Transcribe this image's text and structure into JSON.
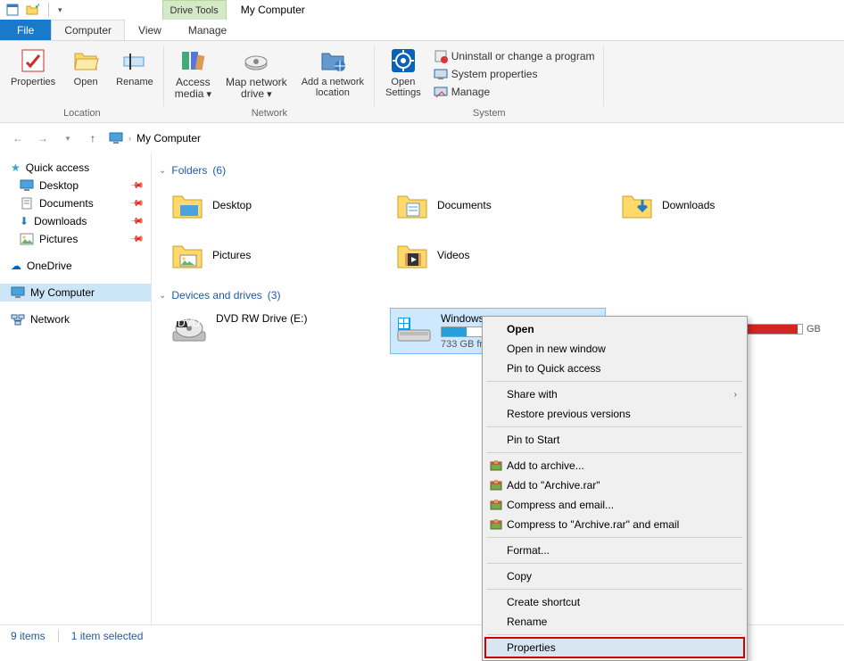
{
  "title": "My Computer",
  "drive_tools_label": "Drive Tools",
  "tabs": {
    "file": "File",
    "computer": "Computer",
    "view": "View",
    "manage": "Manage"
  },
  "ribbon": {
    "location": {
      "label": "Location",
      "properties": "Properties",
      "open": "Open",
      "rename": "Rename"
    },
    "network": {
      "label": "Network",
      "access_media": "Access\nmedia",
      "map_drive": "Map network\ndrive",
      "add_location": "Add a network\nlocation"
    },
    "system": {
      "label": "System",
      "open_settings": "Open\nSettings",
      "uninstall": "Uninstall or change a program",
      "sys_props": "System properties",
      "manage": "Manage"
    }
  },
  "address": "My Computer",
  "sidebar": {
    "quick_access": "Quick access",
    "pinned": [
      {
        "label": "Desktop"
      },
      {
        "label": "Documents"
      },
      {
        "label": "Downloads"
      },
      {
        "label": "Pictures"
      }
    ],
    "onedrive": "OneDrive",
    "my_computer": "My Computer",
    "network": "Network"
  },
  "sections": {
    "folders": {
      "label": "Folders",
      "count": "(6)"
    },
    "devices": {
      "label": "Devices and drives",
      "count": "(3)"
    }
  },
  "folders": [
    {
      "name": "Desktop"
    },
    {
      "name": "Documents"
    },
    {
      "name": "Downloads"
    },
    {
      "name": "Pictures"
    },
    {
      "name": "Videos"
    }
  ],
  "drives": {
    "dvd": {
      "name": "DVD RW Drive (E:)"
    },
    "windows": {
      "name": "Windows",
      "free": "733 GB fre",
      "fill_pct": 18,
      "color": "#26a0da"
    },
    "ghost": {
      "suffix": "GB",
      "fill_pct": 92
    }
  },
  "context_menu": {
    "open": "Open",
    "open_new": "Open in new window",
    "pin_quick": "Pin to Quick access",
    "share": "Share with",
    "restore": "Restore previous versions",
    "pin_start": "Pin to Start",
    "add_archive": "Add to archive...",
    "add_rar": "Add to \"Archive.rar\"",
    "compress_email": "Compress and email...",
    "compress_rar_email": "Compress to \"Archive.rar\" and email",
    "format": "Format...",
    "copy": "Copy",
    "shortcut": "Create shortcut",
    "rename": "Rename",
    "properties": "Properties"
  },
  "status": {
    "items": "9 items",
    "selected": "1 item selected"
  }
}
